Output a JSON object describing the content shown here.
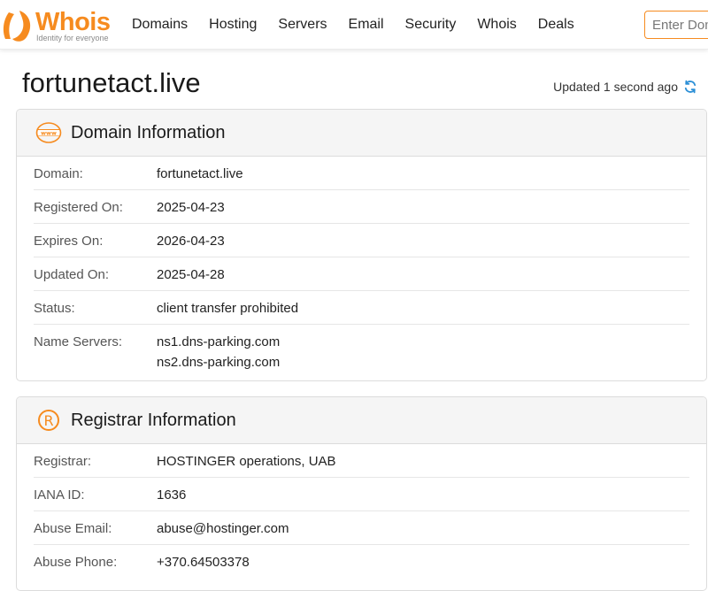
{
  "header": {
    "logo": {
      "word": "Whois",
      "tagline": "Identity for everyone"
    },
    "nav": [
      "Domains",
      "Hosting",
      "Servers",
      "Email",
      "Security",
      "Whois",
      "Deals"
    ],
    "search": {
      "placeholder": "Enter Domain or IP",
      "value": ""
    }
  },
  "page": {
    "title": "fortunetact.live",
    "updated": "Updated 1 second ago"
  },
  "domain_info": {
    "heading": "Domain Information",
    "icon_text": "www",
    "rows": [
      {
        "label": "Domain:",
        "values": [
          "fortunetact.live"
        ]
      },
      {
        "label": "Registered On:",
        "values": [
          "2025-04-23"
        ]
      },
      {
        "label": "Expires On:",
        "values": [
          "2026-04-23"
        ]
      },
      {
        "label": "Updated On:",
        "values": [
          "2025-04-28"
        ]
      },
      {
        "label": "Status:",
        "values": [
          "client transfer prohibited"
        ]
      },
      {
        "label": "Name Servers:",
        "values": [
          "ns1.dns-parking.com",
          "ns2.dns-parking.com"
        ]
      }
    ]
  },
  "registrar_info": {
    "heading": "Registrar Information",
    "icon_text": "R",
    "rows": [
      {
        "label": "Registrar:",
        "values": [
          "HOSTINGER operations, UAB"
        ]
      },
      {
        "label": "IANA ID:",
        "values": [
          "1636"
        ]
      },
      {
        "label": "Abuse Email:",
        "values": [
          "abuse@hostinger.com"
        ]
      },
      {
        "label": "Abuse Phone:",
        "values": [
          "+370.64503378"
        ]
      }
    ]
  },
  "colors": {
    "brand": "#f68b1f",
    "refresh_icon": "#2b8fd6"
  }
}
